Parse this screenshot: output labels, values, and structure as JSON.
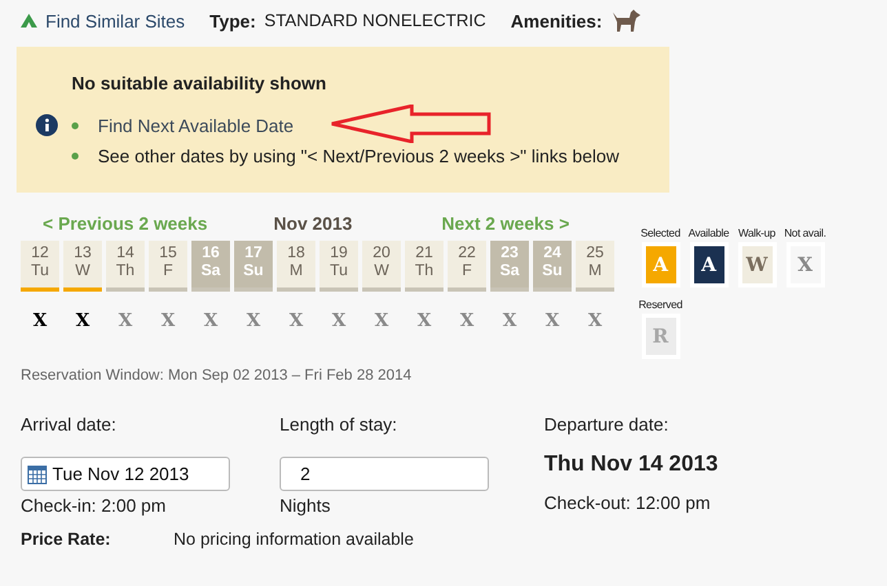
{
  "header": {
    "link": "Find Similar Sites",
    "type_label": "Type:",
    "type_value": "STANDARD NONELECTRIC",
    "amenities_label": "Amenities:"
  },
  "notice": {
    "title": "No suitable availability shown",
    "items": [
      {
        "text": "Find Next Available Date",
        "kind": "link"
      },
      {
        "text": "See other dates by using \"< Next/Previous 2 weeks >\" links below",
        "kind": "text"
      }
    ]
  },
  "calendar": {
    "prev": "< Previous 2 weeks",
    "month": "Nov 2013",
    "next": "Next 2 weeks >",
    "days": [
      {
        "date": "12",
        "weekday": "Tu",
        "weekend": false,
        "selected": true,
        "status": "X"
      },
      {
        "date": "13",
        "weekday": "W",
        "weekend": false,
        "selected": true,
        "status": "X"
      },
      {
        "date": "14",
        "weekday": "Th",
        "weekend": false,
        "selected": false,
        "status": "X"
      },
      {
        "date": "15",
        "weekday": "F",
        "weekend": false,
        "selected": false,
        "status": "X"
      },
      {
        "date": "16",
        "weekday": "Sa",
        "weekend": true,
        "selected": false,
        "status": "X"
      },
      {
        "date": "17",
        "weekday": "Su",
        "weekend": true,
        "selected": false,
        "status": "X"
      },
      {
        "date": "18",
        "weekday": "M",
        "weekend": false,
        "selected": false,
        "status": "X"
      },
      {
        "date": "19",
        "weekday": "Tu",
        "weekend": false,
        "selected": false,
        "status": "X"
      },
      {
        "date": "20",
        "weekday": "W",
        "weekend": false,
        "selected": false,
        "status": "X"
      },
      {
        "date": "21",
        "weekday": "Th",
        "weekend": false,
        "selected": false,
        "status": "X"
      },
      {
        "date": "22",
        "weekday": "F",
        "weekend": false,
        "selected": false,
        "status": "X"
      },
      {
        "date": "23",
        "weekday": "Sa",
        "weekend": true,
        "selected": false,
        "status": "X"
      },
      {
        "date": "24",
        "weekday": "Su",
        "weekend": true,
        "selected": false,
        "status": "X"
      },
      {
        "date": "25",
        "weekday": "M",
        "weekend": false,
        "selected": false,
        "status": "X"
      }
    ]
  },
  "legend": [
    {
      "label": "Selected",
      "letter": "A",
      "kind": "selected"
    },
    {
      "label": "Available",
      "letter": "A",
      "kind": "available"
    },
    {
      "label": "Walk-up",
      "letter": "W",
      "kind": "walkup"
    },
    {
      "label": "Not avail.",
      "letter": "X",
      "kind": "notavail"
    },
    {
      "label": "Reserved",
      "letter": "R",
      "kind": "reserved"
    }
  ],
  "reservation_window": "Reservation Window: Mon Sep 02 2013 – Fri Feb 28 2014",
  "arrival": {
    "label": "Arrival date:",
    "value": "Tue Nov 12 2013",
    "note": "Check-in: 2:00 pm"
  },
  "stay": {
    "label": "Length of stay:",
    "value": "2",
    "note": "Nights"
  },
  "departure": {
    "label": "Departure date:",
    "value": "Thu Nov 14 2013",
    "note": "Check-out: 12:00 pm"
  },
  "price": {
    "label": "Price Rate:",
    "value": "No pricing information available"
  }
}
